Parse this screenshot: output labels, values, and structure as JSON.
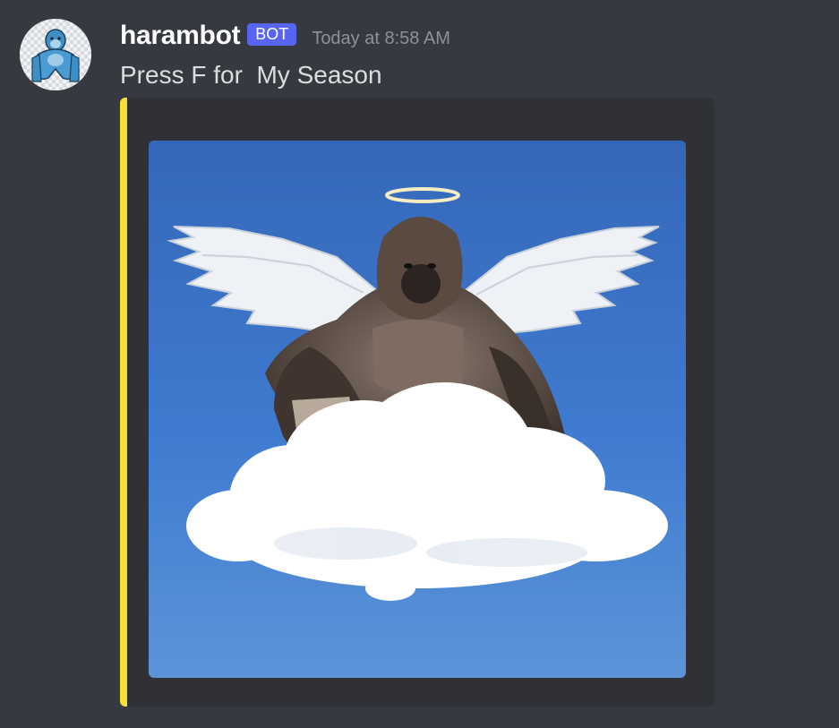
{
  "message": {
    "author": "harambot",
    "bot_tag": "BOT",
    "timestamp": "Today at 8:58 AM",
    "content": "Press F for  My Season",
    "avatar_icon": "gorilla-avatar-icon"
  },
  "embed": {
    "accent_color": "#f4e134",
    "image_icon": "angel-gorilla-on-cloud-image"
  },
  "colors": {
    "background": "#36393f",
    "embed_background": "#2f3136",
    "bot_tag": "#5865f2",
    "username": "#ffffff",
    "timestamp": "#8e9297",
    "content": "#dcddde"
  }
}
